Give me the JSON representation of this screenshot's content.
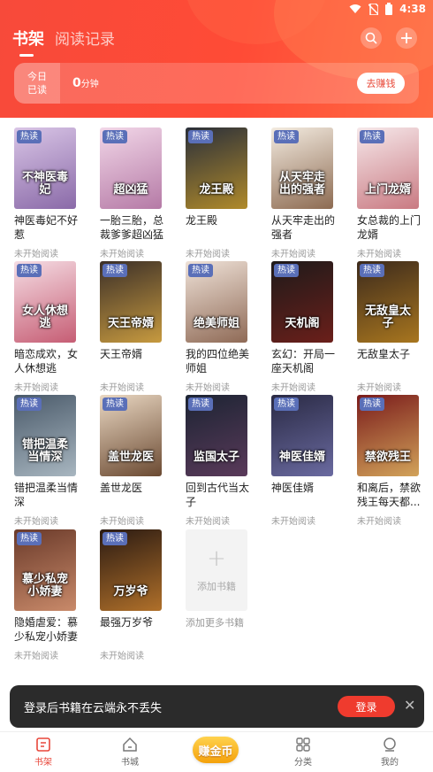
{
  "status_bar": {
    "time": "4:38"
  },
  "header": {
    "tab_bookshelf": "书架",
    "tab_history": "阅读记录",
    "today_label_1": "今日",
    "today_label_2": "已读",
    "today_minutes": "0",
    "today_unit": "分钟",
    "earn_button": "去赚钱"
  },
  "books": [
    {
      "title": "神医毒妃不好惹",
      "cover_text": "不神医毒妃",
      "badge": "热读",
      "status": "未开始阅读",
      "colors": [
        "#d9c5e6",
        "#8a6aa8"
      ]
    },
    {
      "title": "一胎三胎，总裁爹爹超凶猛",
      "cover_text": "超凶猛",
      "badge": "热读",
      "status": "未开始阅读",
      "colors": [
        "#f2d7e8",
        "#b57aa6"
      ]
    },
    {
      "title": "龙王殿",
      "cover_text": "龙王殿",
      "badge": "热读",
      "status": "未开始阅读",
      "colors": [
        "#2a2f3a",
        "#b08a2a"
      ]
    },
    {
      "title": "从天牢走出的强者",
      "cover_text": "从天牢走出的强者",
      "badge": "热读",
      "status": "未开始阅读",
      "colors": [
        "#f3ebe0",
        "#8d6b52"
      ]
    },
    {
      "title": "女总裁的上门龙婿",
      "cover_text": "上门龙婿",
      "badge": "热读",
      "status": "未开始阅读",
      "colors": [
        "#f6e8ea",
        "#c97a82"
      ]
    },
    {
      "title": "暗恋成欢，女人休想逃",
      "cover_text": "女人休想逃",
      "badge": "热读",
      "status": "未开始阅读",
      "colors": [
        "#f5dde4",
        "#c65d74"
      ]
    },
    {
      "title": "天王帝婿",
      "cover_text": "天王帝婿",
      "badge": "热读",
      "status": "未开始阅读",
      "colors": [
        "#3b2f28",
        "#c79a3f"
      ]
    },
    {
      "title": "我的四位绝美师姐",
      "cover_text": "绝美师姐",
      "badge": "热读",
      "status": "未开始阅读",
      "colors": [
        "#efe2d8",
        "#8f6a56"
      ]
    },
    {
      "title": "玄幻：开局一座天机阁",
      "cover_text": "天机阁",
      "badge": "热读",
      "status": "未开始阅读",
      "colors": [
        "#1e1a1a",
        "#6b1f1a"
      ]
    },
    {
      "title": "无敌皇太子",
      "cover_text": "无敌皇太子",
      "badge": "热读",
      "status": "未开始阅读",
      "colors": [
        "#3c2a1c",
        "#a8761f"
      ]
    },
    {
      "title": "错把温柔当情深",
      "cover_text": "错把温柔当情深",
      "badge": "热读",
      "status": "未开始阅读",
      "colors": [
        "#4a5a6a",
        "#a8b6c0"
      ]
    },
    {
      "title": "盖世龙医",
      "cover_text": "盖世龙医",
      "badge": "热读",
      "status": "未开始阅读",
      "colors": [
        "#e9d7c2",
        "#6b4a32"
      ]
    },
    {
      "title": "回到古代当太子",
      "cover_text": "监国太子",
      "badge": "热读",
      "status": "未开始阅读",
      "colors": [
        "#1c2433",
        "#5a3a5a"
      ]
    },
    {
      "title": "神医佳婿",
      "cover_text": "神医佳婿",
      "badge": "热读",
      "status": "未开始阅读",
      "colors": [
        "#2a2a44",
        "#6a6aa0"
      ]
    },
    {
      "title": "和离后，禁欲残王每天都...",
      "cover_text": "禁欲残王",
      "badge": "热读",
      "status": "未开始阅读",
      "colors": [
        "#7a1b1b",
        "#d2a35a"
      ]
    },
    {
      "title": "隐婚虐爱：慕少私宠小娇妻",
      "cover_text": "慕少私宠小娇妻",
      "badge": "热读",
      "status": "未开始阅读",
      "colors": [
        "#6a3a2a",
        "#c98a6a"
      ]
    },
    {
      "title": "最强万岁爷",
      "cover_text": "万岁爷",
      "badge": "热读",
      "status": "未开始阅读",
      "colors": [
        "#2a1a12",
        "#b0702a"
      ]
    }
  ],
  "add_book": {
    "box_label": "添加书籍",
    "caption": "添加更多书籍"
  },
  "toast": {
    "message": "登录后书籍在云端永不丢失",
    "login_button": "登录"
  },
  "bottom_nav": {
    "shelf": "书架",
    "store": "书城",
    "coins": "赚金币",
    "category": "分类",
    "mine": "我的"
  },
  "theme": {
    "accent": "#f04a3a",
    "header": "#ff4b36",
    "badge": "#5a6fb8"
  }
}
